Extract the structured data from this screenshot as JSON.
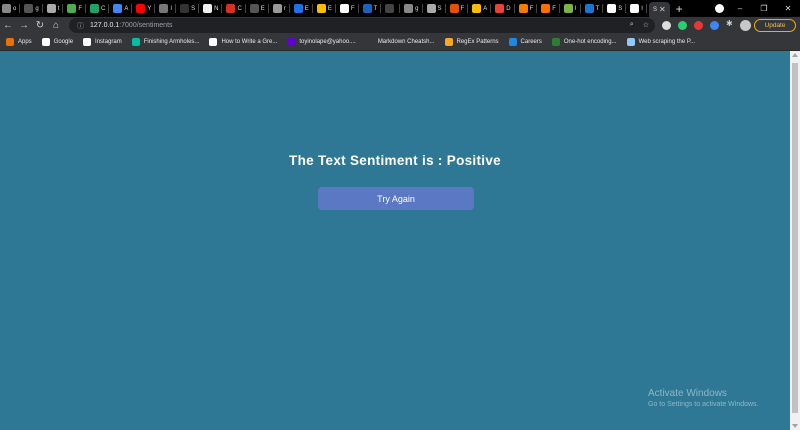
{
  "browser": {
    "tabs": [
      {
        "label": "o",
        "color": "#888888"
      },
      {
        "label": "g",
        "color": "#555555"
      },
      {
        "label": "t",
        "color": "#aaaaaa"
      },
      {
        "label": "F",
        "color": "#4caf50"
      },
      {
        "label": "C",
        "color": "#1da462"
      },
      {
        "label": "A",
        "color": "#4285f4"
      },
      {
        "label": "Y",
        "color": "#ff0000"
      },
      {
        "label": "I",
        "color": "#777777"
      },
      {
        "label": "S",
        "color": "#333333"
      },
      {
        "label": "N",
        "color": "#eeeeee"
      },
      {
        "label": "C",
        "color": "#d93025"
      },
      {
        "label": "E",
        "color": "#555555"
      },
      {
        "label": "r",
        "color": "#999999"
      },
      {
        "label": "E",
        "color": "#1a73e8"
      },
      {
        "label": "E",
        "color": "#fbbc04"
      },
      {
        "label": "F",
        "color": "#ffffff"
      },
      {
        "label": "T",
        "color": "#1565c0"
      },
      {
        "label": "",
        "color": "#444444"
      },
      {
        "label": "g",
        "color": "#888888"
      },
      {
        "label": "S",
        "color": "#aaaaaa"
      },
      {
        "label": "F",
        "color": "#e65100"
      },
      {
        "label": "A",
        "color": "#fbbc04"
      },
      {
        "label": "D",
        "color": "#ea4335"
      },
      {
        "label": "F",
        "color": "#f57c00"
      },
      {
        "label": "F",
        "color": "#ff6f00"
      },
      {
        "label": "I",
        "color": "#7cb342"
      },
      {
        "label": "T",
        "color": "#1976d2"
      },
      {
        "label": "S",
        "color": "#ffffff"
      },
      {
        "label": "I",
        "color": "#ffffff"
      }
    ],
    "active_tab": {
      "label": "S"
    },
    "new_tab": "+",
    "window_controls": {
      "minimize": "–",
      "maximize": "❐",
      "close": "✕"
    },
    "address": {
      "host": "127.0.0.1",
      "path": ":7000/sentiments"
    },
    "update_label": "Update",
    "extension_colors": [
      "#dddddd",
      "#2ecc71",
      "#e53935",
      "#4285f4"
    ],
    "bookmarks": [
      {
        "label": "Apps",
        "color": "#e8710a"
      },
      {
        "label": "Google",
        "color": "#ffffff"
      },
      {
        "label": "Instagram",
        "color": "#ffffff"
      },
      {
        "label": "Finishing Armholes...",
        "color": "#00bfa5"
      },
      {
        "label": "How to Write a Gre...",
        "color": "#ffffff"
      },
      {
        "label": "toyinolape@yahoo....",
        "color": "#6001d2"
      },
      {
        "label": "Markdown Cheatsh...",
        "color": "#35363a"
      },
      {
        "label": "RegEx Patterns",
        "color": "#f9a825"
      },
      {
        "label": "Careers",
        "color": "#1e88e5"
      },
      {
        "label": "One-hot encoding...",
        "color": "#2e7d32"
      },
      {
        "label": "Web scraping the P...",
        "color": "#90caf9"
      }
    ]
  },
  "page": {
    "title": "The Text Sentiment is : Positive",
    "button_label": "Try Again",
    "background": "#2e7896",
    "button_color": "#5b78c4"
  },
  "watermark": {
    "line1": "Activate Windows",
    "line2": "Go to Settings to activate Windows."
  }
}
